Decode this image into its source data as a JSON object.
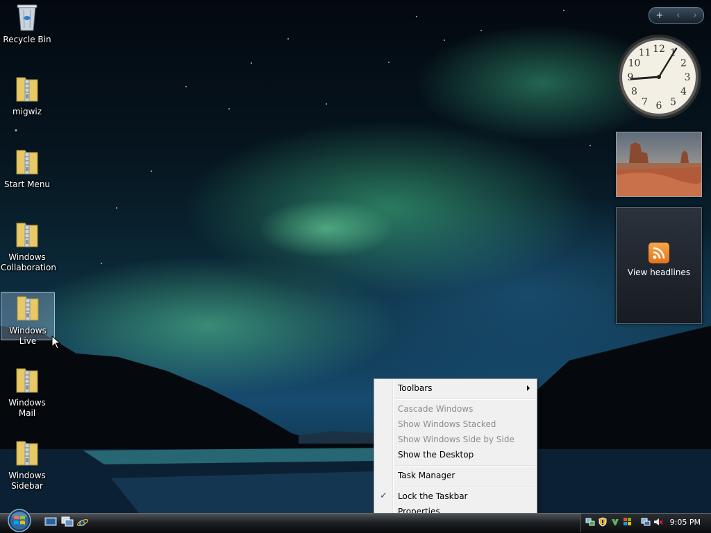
{
  "desktop": {
    "icons": [
      {
        "label": "Recycle Bin",
        "icon": "recycle-bin-icon"
      },
      {
        "label": "migwiz",
        "icon": "zip-folder-icon"
      },
      {
        "label": "Start Menu",
        "icon": "zip-folder-icon"
      },
      {
        "label": "Windows Collaboration",
        "icon": "zip-folder-icon"
      },
      {
        "label": "Windows Live",
        "icon": "zip-folder-icon"
      },
      {
        "label": "Windows Mail",
        "icon": "zip-folder-icon"
      },
      {
        "label": "Windows Sidebar",
        "icon": "zip-folder-icon"
      }
    ]
  },
  "sidebar": {
    "controls": {
      "add": "+",
      "prev": "‹",
      "next": "›"
    },
    "feeds": {
      "label": "View headlines"
    },
    "clock_numbers": [
      "12",
      "1",
      "2",
      "3",
      "4",
      "5",
      "6",
      "7",
      "8",
      "9",
      "10",
      "11"
    ]
  },
  "context_menu": {
    "items": [
      {
        "label": "Toolbars",
        "enabled": true,
        "submenu": true
      },
      {
        "label": "Cascade Windows",
        "enabled": false
      },
      {
        "label": "Show Windows Stacked",
        "enabled": false
      },
      {
        "label": "Show Windows Side by Side",
        "enabled": false
      },
      {
        "label": "Show the Desktop",
        "enabled": true
      },
      {
        "label": "Task Manager",
        "enabled": true
      },
      {
        "label": "Lock the Taskbar",
        "enabled": true,
        "checked": true,
        "check_mark": "✓"
      },
      {
        "label": "Properties",
        "enabled": true
      }
    ]
  },
  "taskbar": {
    "clock": "9:05 PM",
    "quick_launch": [
      "show-desktop-icon",
      "switch-windows-icon",
      "internet-explorer-icon"
    ],
    "tray_icons": [
      "network-icon",
      "security-shield-icon",
      "windows-defender-icon",
      "windows-update-icon",
      "network-connection-icon",
      "volume-muted-icon"
    ]
  },
  "colors": {
    "menu_background": "#f0f0f0",
    "menu_disabled_text": "#8d8d8d",
    "rss_orange": "#e5731b"
  }
}
